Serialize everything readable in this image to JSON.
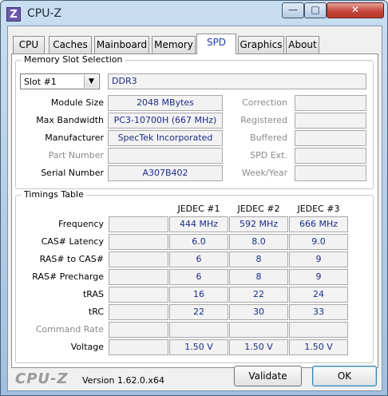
{
  "window": {
    "icon_letter": "Z",
    "title": "CPU-Z",
    "minimize_glyph": "—",
    "maximize_glyph": "□",
    "close_glyph": "✕"
  },
  "tabs": [
    {
      "label": "CPU"
    },
    {
      "label": "Caches"
    },
    {
      "label": "Mainboard"
    },
    {
      "label": "Memory"
    },
    {
      "label": "SPD",
      "active": true
    },
    {
      "label": "Graphics"
    },
    {
      "label": "About"
    }
  ],
  "memory_slot": {
    "legend": "Memory Slot Selection",
    "slot_value": "Slot #1",
    "slot_arrow": "▼",
    "memory_type": "DDR3",
    "fields_left": [
      {
        "label": "Module Size",
        "value": "2048 MBytes"
      },
      {
        "label": "Max Bandwidth",
        "value": "PC3-10700H (667 MHz)"
      },
      {
        "label": "Manufacturer",
        "value": "SpecTek Incorporated"
      },
      {
        "label": "Part Number",
        "value": ""
      },
      {
        "label": "Serial Number",
        "value": "A307B402"
      }
    ],
    "fields_right": [
      {
        "label": "Correction",
        "value": ""
      },
      {
        "label": "Registered",
        "value": ""
      },
      {
        "label": "Buffered",
        "value": ""
      },
      {
        "label": "SPD Ext.",
        "value": ""
      },
      {
        "label": "Week/Year",
        "value": ""
      }
    ]
  },
  "timings": {
    "legend": "Timings Table",
    "columns": [
      "JEDEC #1",
      "JEDEC #2",
      "JEDEC #3"
    ],
    "rows": [
      {
        "label": "Frequency",
        "values": [
          "444 MHz",
          "592 MHz",
          "666 MHz"
        ]
      },
      {
        "label": "CAS# Latency",
        "values": [
          "6.0",
          "8.0",
          "9.0"
        ]
      },
      {
        "label": "RAS# to CAS#",
        "values": [
          "6",
          "8",
          "9"
        ]
      },
      {
        "label": "RAS# Precharge",
        "values": [
          "6",
          "8",
          "9"
        ]
      },
      {
        "label": "tRAS",
        "values": [
          "16",
          "22",
          "24"
        ]
      },
      {
        "label": "tRC",
        "values": [
          "22",
          "30",
          "33"
        ]
      },
      {
        "label": "Command Rate",
        "values": [
          "",
          "",
          ""
        ]
      },
      {
        "label": "Voltage",
        "values": [
          "1.50 V",
          "1.50 V",
          "1.50 V"
        ]
      }
    ]
  },
  "footer": {
    "logo": "CPU-Z",
    "version": "Version 1.62.0.x64",
    "validate_label": "Validate",
    "ok_label": "OK"
  }
}
